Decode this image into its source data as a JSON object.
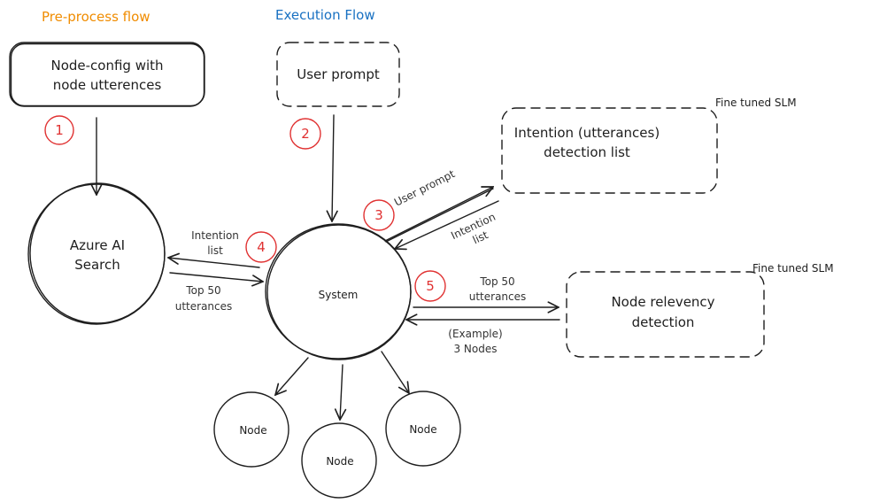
{
  "titles": {
    "preprocess": "Pre-process flow",
    "execution": "Execution Flow"
  },
  "colors": {
    "preprocess": "#f08c00",
    "execution": "#1971c2",
    "badge": "#e03131",
    "stroke": "#1e1e1e"
  },
  "nodes": {
    "node_config": [
      "Node-config with",
      "node utterences"
    ],
    "user_prompt": "User prompt",
    "intention_detection": [
      "Intention (utterances)",
      "detection list"
    ],
    "intention_detection_note": "Fine tuned SLM",
    "azure_search": [
      "Azure AI",
      "Search"
    ],
    "system": "System",
    "node_relevency": [
      "Node relevency",
      "detection"
    ],
    "node_relevency_note": "Fine tuned SLM",
    "leaf_nodes": [
      "Node",
      "Node",
      "Node"
    ]
  },
  "badges": [
    "1",
    "2",
    "3",
    "4",
    "5"
  ],
  "edge_labels": {
    "system_to_intention": "User prompt",
    "intention_to_system": [
      "Intention",
      "list"
    ],
    "system_to_azure": [
      "Intention",
      "list"
    ],
    "azure_to_system": [
      "Top 50",
      "utterances"
    ],
    "system_to_relevency": [
      "Top 50",
      "utterances"
    ],
    "relevency_to_system": [
      "(Example)",
      "3 Nodes"
    ]
  }
}
